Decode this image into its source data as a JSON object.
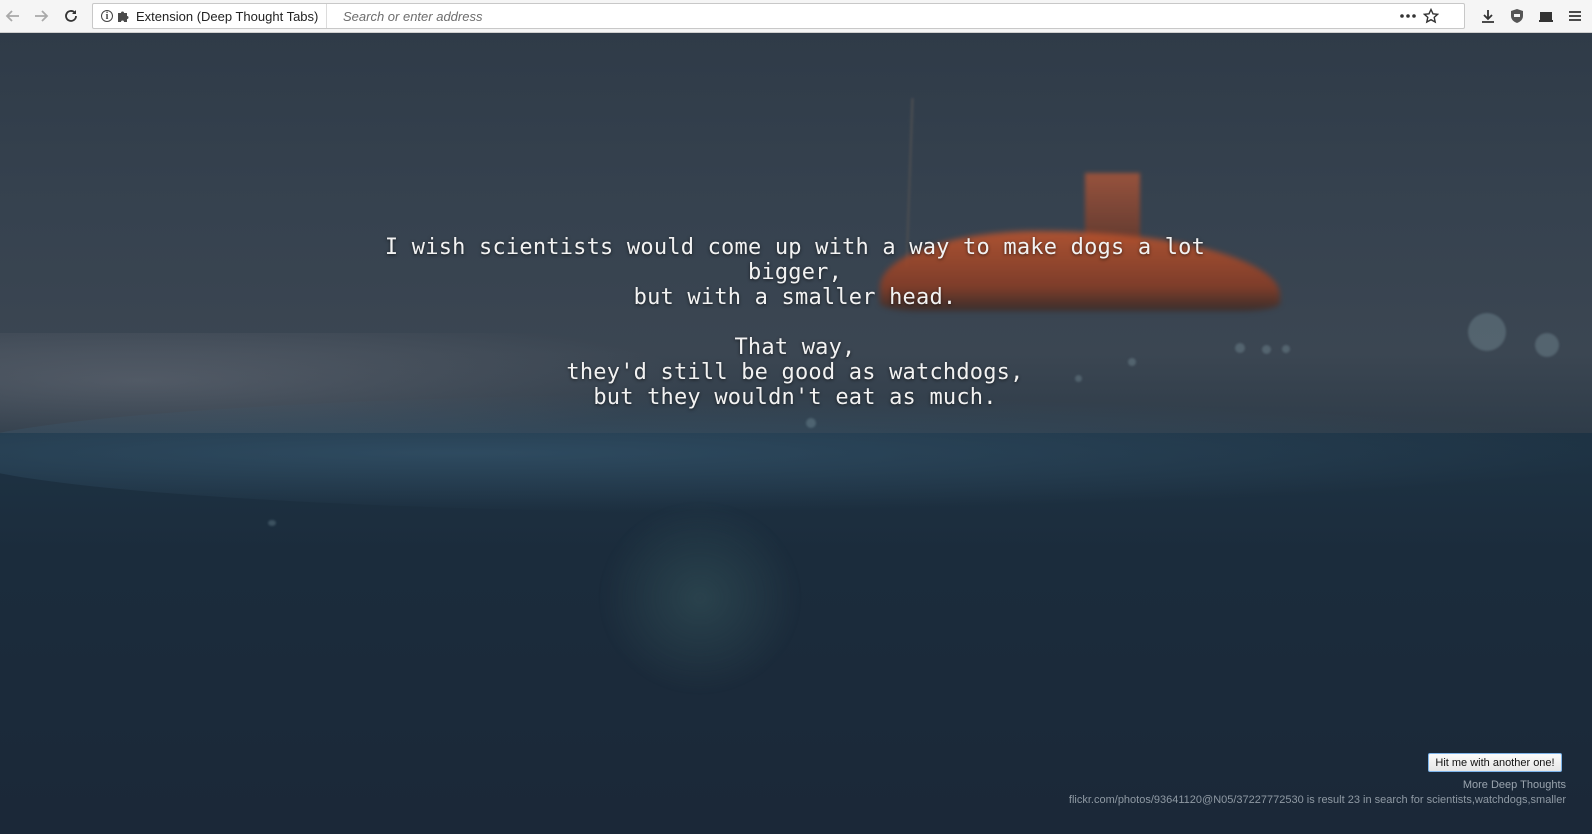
{
  "toolbar": {
    "identity_label": "Extension (Deep Thought Tabs)",
    "url_placeholder": "Search or enter address"
  },
  "icons": {
    "back": "arrow-left-icon",
    "forward": "arrow-right-icon",
    "reload": "reload-icon",
    "info": "info-icon",
    "extension": "puzzle-icon",
    "page_actions": "more-dots-icon",
    "bookmark": "star-icon",
    "downloads": "download-icon",
    "shield": "shield-icon",
    "library": "library-icon",
    "menu": "hamburger-menu-icon"
  },
  "quote": {
    "lines": [
      "I wish scientists would come up with a way to make dogs a lot",
      "bigger,",
      "but with a smaller head.",
      "",
      "That way,",
      "they'd still be good as watchdogs,",
      "but they wouldn't eat as much."
    ]
  },
  "footer": {
    "button_label": "Hit me with another one!",
    "more_link": "More Deep Thoughts",
    "credit": "flickr.com/photos/93641120@N05/37227772530 is result 23 in search for scientists,watchdogs,smaller"
  },
  "colors": {
    "toolbar_bg": "#f5f5f5",
    "quote_text": "#f2f2f2",
    "button_border": "#7eb4ea"
  }
}
